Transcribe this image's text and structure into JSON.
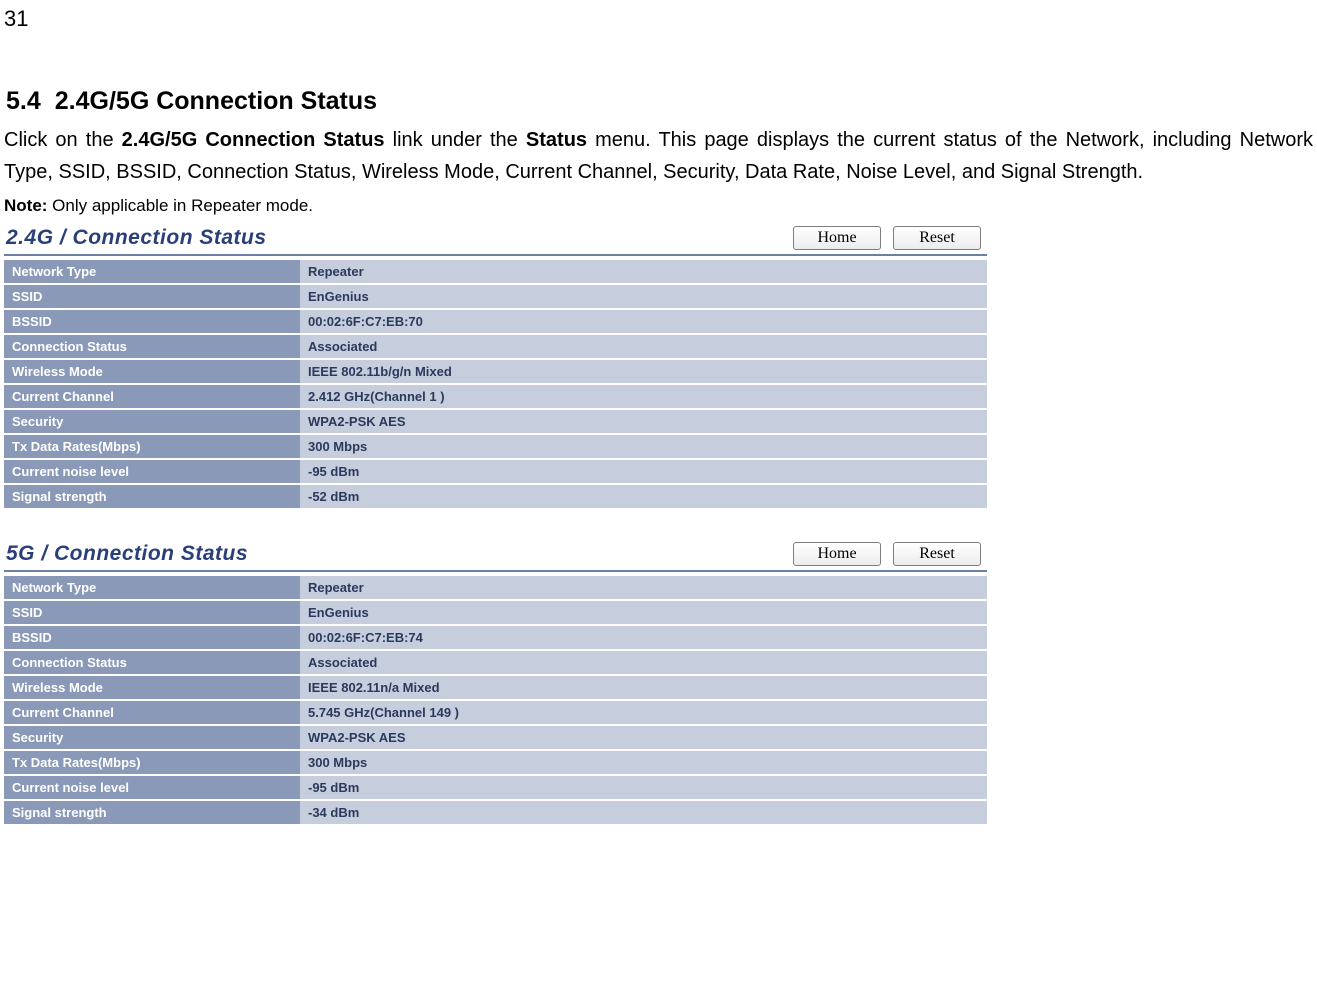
{
  "page_number": "31",
  "section": {
    "number": "5.4",
    "title": "2.4G/5G Connection Status"
  },
  "intro": {
    "pre": "Click on the ",
    "bold1": "2.4G/5G Connection Status",
    "mid1": " link under the ",
    "bold2": "Status",
    "post": " menu. This page displays the current status of the Network, including Network Type, SSID, BSSID, Connection Status, Wireless Mode, Current Channel, Security, Data Rate, Noise Level, and Signal Strength."
  },
  "note": {
    "label": "Note:",
    "text": " Only applicable in Repeater mode."
  },
  "buttons": {
    "home": "Home",
    "reset": "Reset"
  },
  "labels": {
    "network_type": "Network Type",
    "ssid": "SSID",
    "bssid": "BSSID",
    "connection_status": "Connection Status",
    "wireless_mode": "Wireless Mode",
    "current_channel": "Current Channel",
    "security": "Security",
    "tx_data_rates": "Tx Data Rates(Mbps)",
    "current_noise": "Current noise level",
    "signal_strength": "Signal strength"
  },
  "panel_2g": {
    "title": "2.4G / Connection Status",
    "values": {
      "network_type": "Repeater",
      "ssid": "EnGenius",
      "bssid": "00:02:6F:C7:EB:70",
      "connection_status": "Associated",
      "wireless_mode": "IEEE 802.11b/g/n Mixed",
      "current_channel": "2.412 GHz(Channel 1 )",
      "security": "WPA2-PSK AES",
      "tx_data_rates": "300 Mbps",
      "current_noise": "-95 dBm",
      "signal_strength": "-52 dBm"
    }
  },
  "panel_5g": {
    "title": "5G / Connection Status",
    "values": {
      "network_type": "Repeater",
      "ssid": "EnGenius",
      "bssid": "00:02:6F:C7:EB:74",
      "connection_status": "Associated",
      "wireless_mode": "IEEE 802.11n/a Mixed",
      "current_channel": "5.745 GHz(Channel 149 )",
      "security": "WPA2-PSK AES",
      "tx_data_rates": "300 Mbps",
      "current_noise": "-95 dBm",
      "signal_strength": "-34 dBm"
    }
  }
}
